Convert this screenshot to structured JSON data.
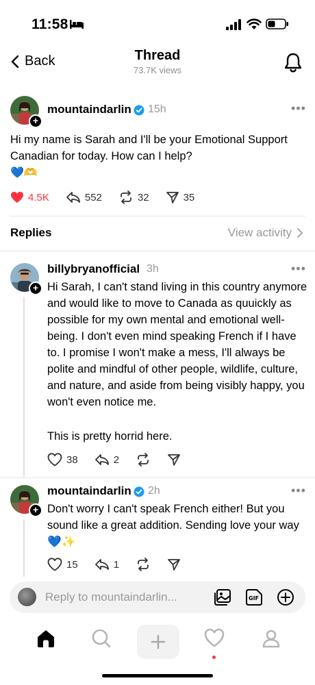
{
  "status": {
    "time": "11:58"
  },
  "nav": {
    "back_label": "Back",
    "title": "Thread",
    "views": "73.7K views"
  },
  "post": {
    "username": "mountaindarlin",
    "time": "15h",
    "text": "Hi my name is Sarah and I'll be your Emotional Support Canadian for today. How can I help?",
    "emojis": "💙🫶",
    "likes": "4.5K",
    "replies": "552",
    "reposts": "32",
    "shares": "35"
  },
  "replies_header": {
    "title": "Replies",
    "view_activity": "View activity"
  },
  "replies": [
    {
      "username": "billybryanofficial",
      "time": "3h",
      "text": "Hi Sarah, I can't stand living in this country anymore and would like to move to Canada as quuickly as possible for my own mental and emotional well-being. I don't even mind speaking French if I have to. I promise I won't make a mess, I'll always be polite and mindful of other people, wildlife, culture, and nature, and aside from being visibly happy, you won't even notice me.",
      "text2": "This is pretty horrid here.",
      "likes": "38",
      "replies": "2"
    },
    {
      "username": "mountaindarlin",
      "time": "2h",
      "text": "Don't worry I can't speak French either! But you sound like a great addition. Sending love your way 💙✨",
      "likes": "15",
      "replies": "1"
    }
  ],
  "reply_input": {
    "placeholder": "Reply to mountaindarlin..."
  },
  "colors": {
    "like": "#ff3040",
    "verified": "#1d9bf0",
    "muted": "#999999"
  }
}
